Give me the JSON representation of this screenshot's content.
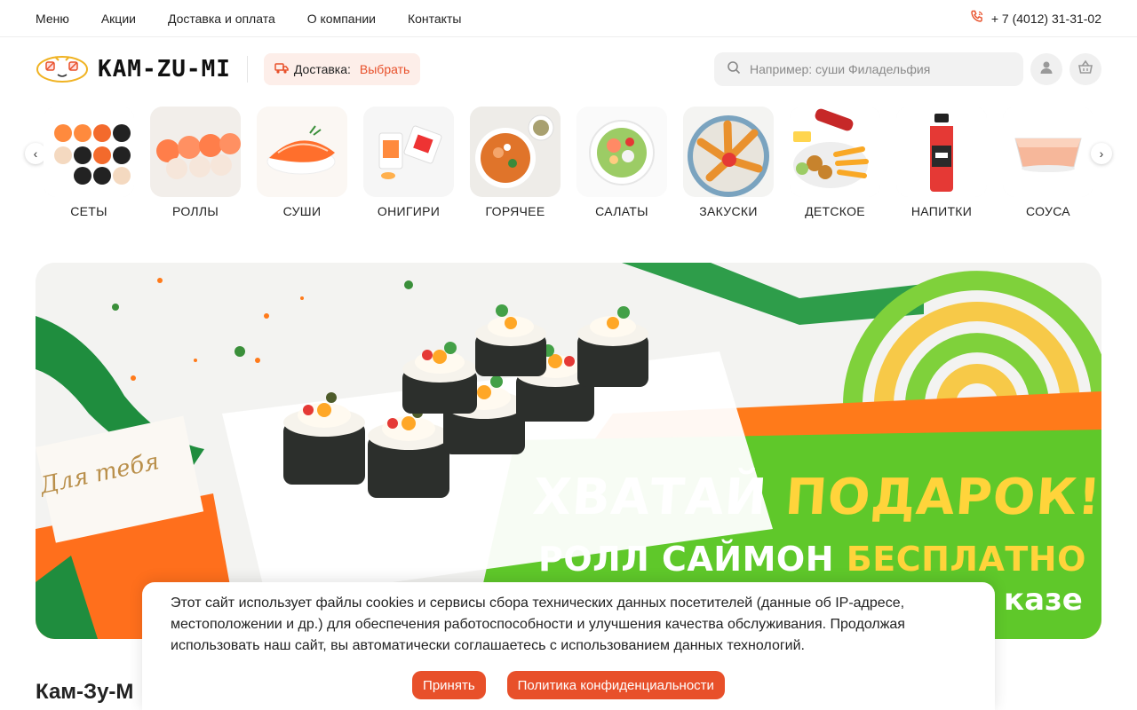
{
  "topnav": {
    "items": [
      "Меню",
      "Акции",
      "Доставка и оплата",
      "О компании",
      "Контакты"
    ],
    "phone": "+ 7 (4012) 31-31-02"
  },
  "header": {
    "logo_text": "KAM-ZU-MI",
    "delivery_label": "Доставка:",
    "delivery_choose": "Выбрать",
    "search_placeholder": "Например: суши Филадельфия"
  },
  "categories": [
    "СЕТЫ",
    "РОЛЛЫ",
    "СУШИ",
    "ОНИГИРИ",
    "ГОРЯЧЕЕ",
    "САЛАТЫ",
    "ЗАКУСКИ",
    "ДЕТСКОЕ",
    "НАПИТКИ",
    "СОУСА"
  ],
  "banner": {
    "line1_white": "ХВАТАЙ ",
    "line1_yellow": "ПОДАРОК!",
    "line2_white": "РОЛЛ САЙМОН ",
    "line2_yellow": "БЕСПЛАТНО",
    "line3_partial": "казе",
    "card_text": "Для тебя"
  },
  "page_title": "Кам-Зу-М",
  "cookie": {
    "text": "Этот сайт использует файлы cookies и сервисы сбора технических данных посетителей (данные об IP-адресе, местоположении и др.) для обеспечения работоспособности и улучшения качества обслуживания. Продолжая использовать наш сайт, вы автоматически соглашаетесь с использованием данных технологий.",
    "accept": "Принять",
    "policy": "Политика конфиденциальности"
  },
  "colors": {
    "accent": "#e8502a",
    "green": "#5fc82a",
    "orange": "#ff7a1a",
    "yellow": "#ffd43b"
  }
}
